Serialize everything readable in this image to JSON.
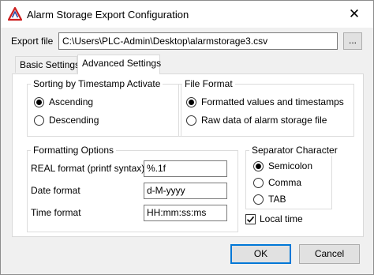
{
  "window": {
    "title": "Alarm Storage Export Configuration",
    "close_glyph": "✕"
  },
  "export": {
    "label": "Export file",
    "path": "C:\\Users\\PLC-Admin\\Desktop\\alarmstorage3.csv",
    "browse_label": "..."
  },
  "tabs": [
    {
      "label": "Basic Settings",
      "active": false
    },
    {
      "label": "Advanced Settings",
      "active": true
    }
  ],
  "sorting": {
    "title": "Sorting by Timestamp Activate",
    "options": [
      {
        "label": "Ascending",
        "selected": true
      },
      {
        "label": "Descending",
        "selected": false
      }
    ]
  },
  "file_format": {
    "title": "File Format",
    "options": [
      {
        "label": "Formatted values and timestamps",
        "selected": true
      },
      {
        "label": "Raw data of alarm storage file",
        "selected": false
      }
    ]
  },
  "formatting": {
    "title": "Formatting Options",
    "real_label": "REAL format (printf syntax)",
    "real_value": "%.1f",
    "date_label": "Date format",
    "date_value": "d-M-yyyy",
    "time_label": "Time format",
    "time_value": "HH:mm:ss:ms"
  },
  "separator": {
    "title": "Separator Character",
    "options": [
      {
        "label": "Semicolon",
        "selected": true
      },
      {
        "label": "Comma",
        "selected": false
      },
      {
        "label": "TAB",
        "selected": false
      }
    ]
  },
  "local_time": {
    "label": "Local time",
    "checked": true
  },
  "buttons": {
    "ok": "OK",
    "cancel": "Cancel"
  },
  "icons": {
    "app": "warning-triangle-icon",
    "close": "close-icon",
    "check": "checkmark-icon"
  },
  "colors": {
    "accent": "#0078d7",
    "app_icon": "#cc1f1f"
  }
}
